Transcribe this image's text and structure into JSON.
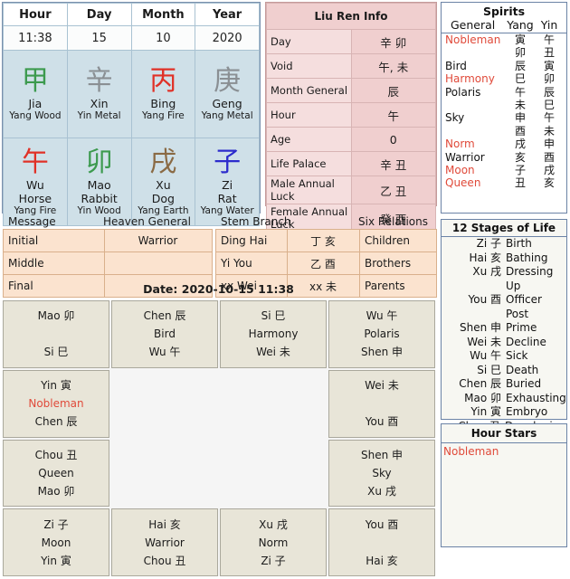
{
  "bazi": {
    "headers": [
      "Hour",
      "Day",
      "Month",
      "Year"
    ],
    "values": [
      "11:38",
      "15",
      "10",
      "2020"
    ],
    "stems": [
      {
        "cjk": "甲",
        "pinyin": "Jia",
        "element": "Yang Wood",
        "color": "#3c9a4e"
      },
      {
        "cjk": "辛",
        "pinyin": "Xin",
        "element": "Yin Metal",
        "color": "#8a8f93"
      },
      {
        "cjk": "丙",
        "pinyin": "Bing",
        "element": "Yang Fire",
        "color": "#e03127"
      },
      {
        "cjk": "庚",
        "pinyin": "Geng",
        "element": "Yang Metal",
        "color": "#8a8f93"
      }
    ],
    "branches": [
      {
        "cjk": "午",
        "pinyin": "Wu",
        "animal": "Horse",
        "element": "Yang Fire",
        "color": "#e03127"
      },
      {
        "cjk": "卯",
        "pinyin": "Mao",
        "animal": "Rabbit",
        "element": "Yin Wood",
        "color": "#3c9a4e"
      },
      {
        "cjk": "戌",
        "pinyin": "Xu",
        "animal": "Dog",
        "element": "Yang Earth",
        "color": "#8a6a44"
      },
      {
        "cjk": "子",
        "pinyin": "Zi",
        "animal": "Rat",
        "element": "Yang Water",
        "color": "#2c2ccc"
      }
    ]
  },
  "liuren": {
    "title": "Liu Ren Info",
    "rows": [
      {
        "label": "Day",
        "value": "辛 卯"
      },
      {
        "label": "Void",
        "value": "午, 未"
      },
      {
        "label": "Month General",
        "value": "辰"
      },
      {
        "label": "Hour",
        "value": "午"
      },
      {
        "label": "Age",
        "value": "0"
      },
      {
        "label": "Life Palace",
        "value": "辛 丑"
      },
      {
        "label": "Male Annual Luck",
        "value": "乙 丑"
      },
      {
        "label": "Female Annual Luck",
        "value": "癸 酉"
      }
    ]
  },
  "spirits": {
    "title": "Spirits",
    "col_general": "General",
    "col_yang": "Yang",
    "col_yin": "Yin",
    "rows": [
      {
        "general": "Nobleman",
        "yang": "寅",
        "yin": "午",
        "red": true
      },
      {
        "general": "",
        "yang": "卯",
        "yin": "丑",
        "red": false
      },
      {
        "general": "Bird",
        "yang": "辰",
        "yin": "寅",
        "red": false
      },
      {
        "general": "Harmony",
        "yang": "巳",
        "yin": "卯",
        "red": true
      },
      {
        "general": "Polaris",
        "yang": "午",
        "yin": "辰",
        "red": false
      },
      {
        "general": "",
        "yang": "未",
        "yin": "巳",
        "red": false
      },
      {
        "general": "Sky",
        "yang": "申",
        "yin": "午",
        "red": false
      },
      {
        "general": "",
        "yang": "酉",
        "yin": "未",
        "red": false
      },
      {
        "general": "Norm",
        "yang": "戌",
        "yin": "申",
        "red": true
      },
      {
        "general": "Warrior",
        "yang": "亥",
        "yin": "酉",
        "red": false
      },
      {
        "general": "Moon",
        "yang": "子",
        "yin": "戌",
        "red": true
      },
      {
        "general": "Queen",
        "yang": "丑",
        "yin": "亥",
        "red": true
      }
    ]
  },
  "message_table": {
    "col_message": "Message",
    "col_heaven_general": "Heaven General",
    "rows": [
      {
        "message": "Initial",
        "heaven_general": "Warrior"
      },
      {
        "message": "Middle",
        "heaven_general": ""
      },
      {
        "message": "Final",
        "heaven_general": ""
      }
    ]
  },
  "stem_branch_table": {
    "col_stem_branch": "Stem Branch",
    "col_six_relations": "Six Relations",
    "rows": [
      {
        "pinyin": "Ding Hai",
        "cjk": "丁 亥",
        "relation": "Children"
      },
      {
        "pinyin": "Yi You",
        "cjk": "乙 酉",
        "relation": "Brothers"
      },
      {
        "pinyin": "xx Wei",
        "cjk": "xx 未",
        "relation": "Parents"
      }
    ]
  },
  "date_line": "Date: 2020-10-15 11:38",
  "grid": {
    "cells": [
      {
        "l1": "Mao 卯",
        "l2": "",
        "l3": "Si 巳",
        "l2_red": false,
        "empty": false
      },
      {
        "l1": "Chen 辰",
        "l2": "Bird",
        "l3": "Wu 午",
        "l2_red": false,
        "empty": false
      },
      {
        "l1": "Si 巳",
        "l2": "Harmony",
        "l3": "Wei 未",
        "l2_red": false,
        "empty": false
      },
      {
        "l1": "Wu 午",
        "l2": "Polaris",
        "l3": "Shen 申",
        "l2_red": false,
        "empty": false
      },
      {
        "l1": "Yin 寅",
        "l2": "Nobleman",
        "l3": "Chen 辰",
        "l2_red": true,
        "empty": false
      },
      {
        "l1": "",
        "l2": "",
        "l3": "",
        "l2_red": false,
        "empty": true
      },
      {
        "l1": "",
        "l2": "",
        "l3": "",
        "l2_red": false,
        "empty": true
      },
      {
        "l1": "Wei 未",
        "l2": "",
        "l3": "You 酉",
        "l2_red": false,
        "empty": false
      },
      {
        "l1": "Chou 丑",
        "l2": "Queen",
        "l3": "Mao 卯",
        "l2_red": false,
        "empty": false
      },
      {
        "l1": "",
        "l2": "",
        "l3": "",
        "l2_red": false,
        "empty": true
      },
      {
        "l1": "",
        "l2": "",
        "l3": "",
        "l2_red": false,
        "empty": true
      },
      {
        "l1": "Shen 申",
        "l2": "Sky",
        "l3": "Xu 戌",
        "l2_red": false,
        "empty": false
      },
      {
        "l1": "Zi 子",
        "l2": "Moon",
        "l3": "Yin 寅",
        "l2_red": false,
        "empty": false
      },
      {
        "l1": "Hai 亥",
        "l2": "Warrior",
        "l3": "Chou 丑",
        "l2_red": false,
        "empty": false
      },
      {
        "l1": "Xu 戌",
        "l2": "Norm",
        "l3": "Zi 子",
        "l2_red": false,
        "empty": false
      },
      {
        "l1": "You 酉",
        "l2": "",
        "l3": "Hai 亥",
        "l2_red": false,
        "empty": false
      }
    ]
  },
  "stages": {
    "title": "12 Stages of Life",
    "rows": [
      {
        "branch": "Zi 子",
        "stage": "Birth"
      },
      {
        "branch": "Hai 亥",
        "stage": "Bathing"
      },
      {
        "branch": "Xu 戌",
        "stage": "Dressing Up"
      },
      {
        "branch": "You 酉",
        "stage": "Officer Post"
      },
      {
        "branch": "Shen 申",
        "stage": "Prime"
      },
      {
        "branch": "Wei 未",
        "stage": "Decline"
      },
      {
        "branch": "Wu 午",
        "stage": "Sick"
      },
      {
        "branch": "Si 巳",
        "stage": "Death"
      },
      {
        "branch": "Chen 辰",
        "stage": "Buried"
      },
      {
        "branch": "Mao 卯",
        "stage": "Exhausting"
      },
      {
        "branch": "Yin 寅",
        "stage": "Embryo"
      },
      {
        "branch": "Chou 丑",
        "stage": "Developing"
      }
    ]
  },
  "hour_stars": {
    "title": "Hour Stars",
    "items": [
      "Nobleman"
    ]
  },
  "colors": {
    "pillar_bg": "#cfe0e8",
    "liuren_bg": "#f3d7d7",
    "peach_bg": "#fbe3cf",
    "grid_bg": "#e8e5d8",
    "accent_red": "#e04a3a",
    "panel_border": "#6b83a6"
  }
}
